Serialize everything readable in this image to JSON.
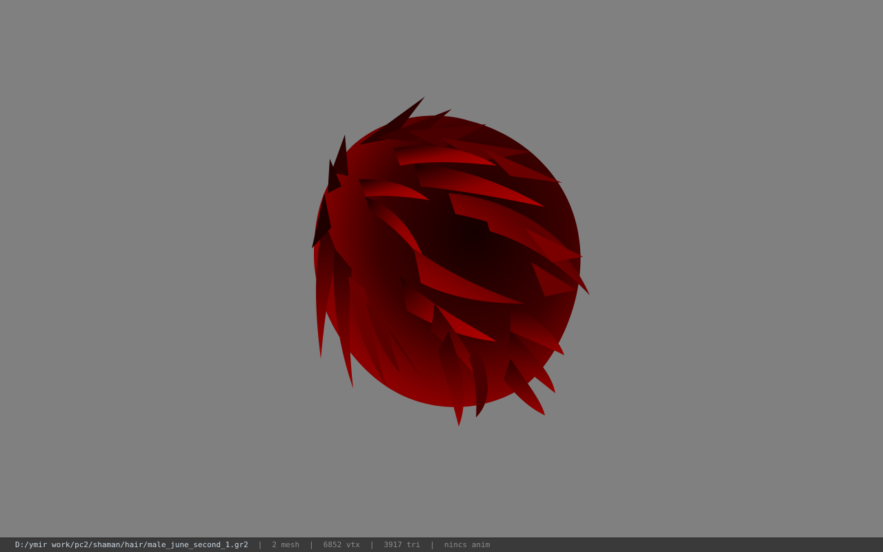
{
  "viewport": {
    "background": "#808080",
    "model_colors": {
      "dark": "#1a0000",
      "mid": "#5a0000",
      "bright": "#b00000"
    }
  },
  "statusbar": {
    "file_path": "D:/ymir work/pc2/shaman/hair/male_june_second_1.gr2",
    "separator": "|",
    "mesh": "2 mesh",
    "vtx": "6852 vtx",
    "tri": "3917 tri",
    "anim": "nincs anim"
  }
}
